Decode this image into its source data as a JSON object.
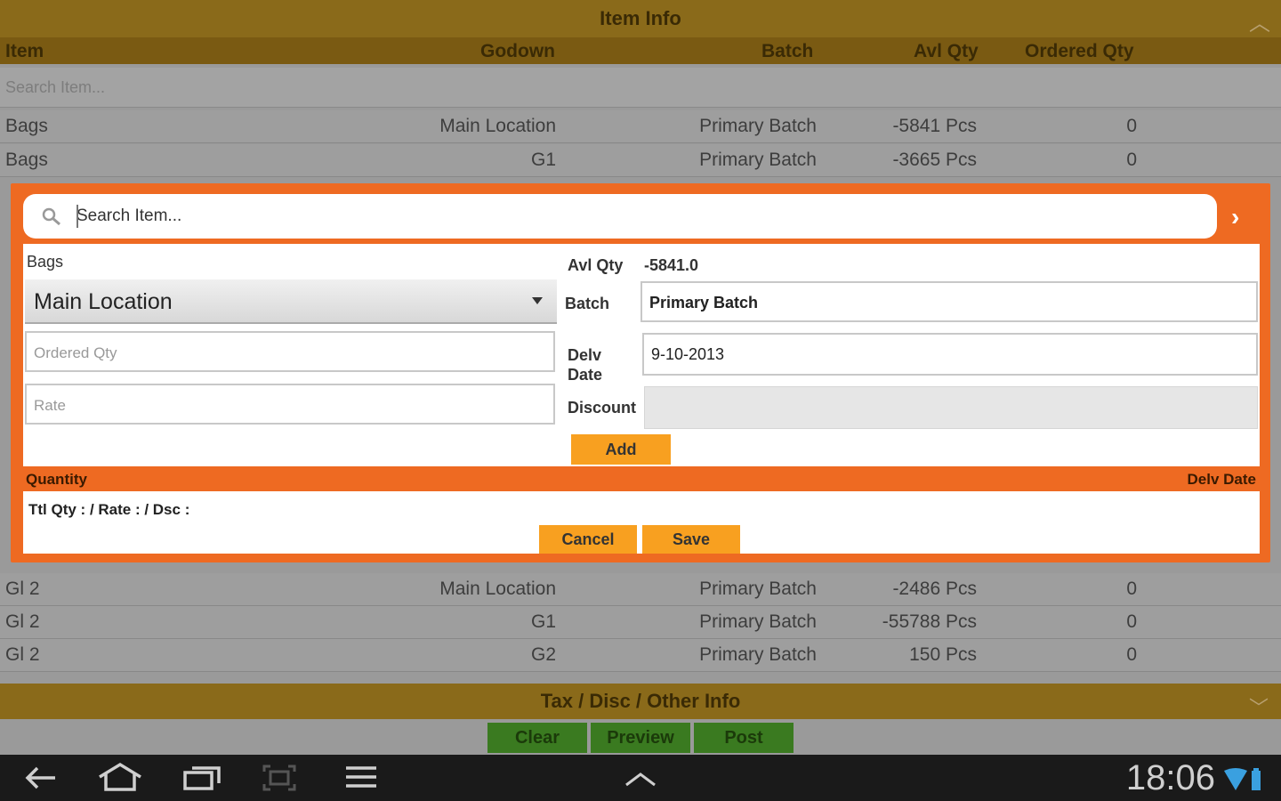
{
  "header": {
    "title": "Item Info",
    "collapse_icon": "chevron-up-icon"
  },
  "columns": {
    "item": "Item",
    "godown": "Godown",
    "batch": "Batch",
    "avl_qty": "Avl Qty",
    "ordered_qty": "Ordered Qty"
  },
  "search": {
    "placeholder": "Search Item..."
  },
  "rows_top": [
    {
      "item": "Bags",
      "godown": "Main Location",
      "batch": "Primary Batch",
      "avl": "-5841 Pcs",
      "ord": "0"
    },
    {
      "item": "Bags",
      "godown": "G1",
      "batch": "Primary Batch",
      "avl": "-3665 Pcs",
      "ord": "0"
    }
  ],
  "rows_bottom": [
    {
      "item": "Gl 2",
      "godown": "Main Location",
      "batch": "Primary Batch",
      "avl": "-2486 Pcs",
      "ord": "0"
    },
    {
      "item": "Gl 2",
      "godown": "G1",
      "batch": "Primary Batch",
      "avl": "-55788 Pcs",
      "ord": "0"
    },
    {
      "item": "Gl 2",
      "godown": "G2",
      "batch": "Primary Batch",
      "avl": "150 Pcs",
      "ord": "0"
    }
  ],
  "tax_bar": {
    "title": "Tax / Disc / Other Info"
  },
  "actions": {
    "clear": "Clear",
    "preview": "Preview",
    "post": "Post"
  },
  "dialog": {
    "search_placeholder": "Search Item...",
    "item_name": "Bags",
    "godown_selected": "Main Location",
    "avl_qty_label": "Avl Qty",
    "avl_qty_value": "-5841.0",
    "batch_label": "Batch",
    "batch_value": "Primary Batch",
    "ordered_qty_placeholder": "Ordered Qty",
    "rate_placeholder": "Rate",
    "delv_label_1": "Delv",
    "delv_label_2": "Date",
    "delv_date_value": "9-10-2013",
    "discount_label": "Discount",
    "add": "Add",
    "quantity_header": "Quantity",
    "delv_date_header": "Delv Date",
    "totals": "Ttl Qty :  / Rate :  / Dsc :",
    "cancel": "Cancel",
    "save": "Save"
  },
  "system": {
    "clock": "18:06"
  },
  "colors": {
    "dialog_orange": "#ee6a22",
    "button_orange": "#f8a020",
    "header_gold": "#8a6a1a",
    "action_green": "#3a7a20"
  }
}
